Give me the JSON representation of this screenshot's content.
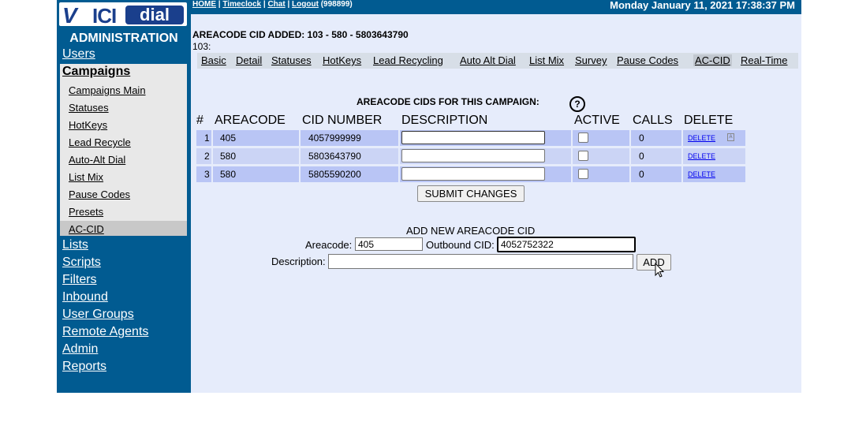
{
  "logo": {
    "v": "V",
    "ici": "ICI",
    "dial": "dial"
  },
  "sidebar": {
    "title": "ADMINISTRATION",
    "users": "Users",
    "campaigns": "Campaigns",
    "sub": [
      "Campaigns Main",
      "Statuses",
      "HotKeys",
      "Lead Recycle",
      "Auto-Alt Dial",
      "List Mix",
      "Pause Codes",
      "Presets",
      "AC-CID"
    ],
    "bottom": [
      "Lists",
      "Scripts",
      "Filters",
      "Inbound",
      "User Groups",
      "Remote Agents",
      "Admin",
      "Reports"
    ]
  },
  "topbar": {
    "home": "HOME",
    "sep": " | ",
    "timeclock": "Timeclock",
    "chat": "Chat",
    "logout": "Logout",
    "user": " (998899)",
    "date": "Monday January 11, 2021 17:38:37 PM"
  },
  "main": {
    "added_msg": "AREACODE CID ADDED: 103 - 580 - 5803643790",
    "added_num": "103:",
    "tabs": [
      "Basic",
      "Detail",
      "Statuses",
      "HotKeys",
      "Lead Recycling",
      "Auto Alt Dial",
      "List Mix",
      "Survey",
      "Pause Codes",
      "AC-CID",
      "Real-Time"
    ],
    "section_title": "AREACODE CIDS FOR THIS CAMPAIGN:",
    "help": "?",
    "headers": [
      "#",
      "AREACODE",
      "CID NUMBER",
      "DESCRIPTION",
      "ACTIVE",
      "CALLS",
      "DELETE"
    ],
    "rows": [
      {
        "n": "1",
        "areacode": "405",
        "cid": "4057999999",
        "desc": "",
        "calls": "0",
        "del": "DELETE"
      },
      {
        "n": "2",
        "areacode": "580",
        "cid": "5803643790",
        "desc": "",
        "calls": "0",
        "del": "DELETE"
      },
      {
        "n": "3",
        "areacode": "580",
        "cid": "5805590200",
        "desc": "",
        "calls": "0",
        "del": "DELETE"
      }
    ],
    "submit": "SUBMIT CHANGES",
    "add_title": "ADD NEW AREACODE CID",
    "areacode_label": "Areacode:",
    "areacode_value": "405",
    "outbound_label": "Outbound CID:",
    "outbound_value": "4052752322",
    "description_label": "Description:",
    "description_value": "",
    "add_btn": "ADD"
  }
}
